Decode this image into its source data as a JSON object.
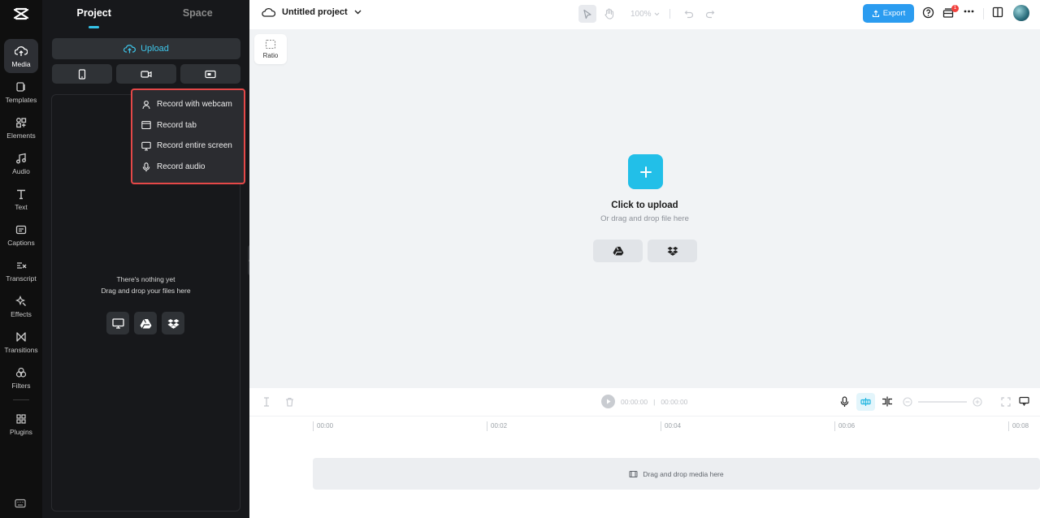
{
  "rail": {
    "items": [
      {
        "label": "Media",
        "icon": "cloud-upload-icon"
      },
      {
        "label": "Templates",
        "icon": "templates-icon"
      },
      {
        "label": "Elements",
        "icon": "elements-icon"
      },
      {
        "label": "Audio",
        "icon": "music-note-icon"
      },
      {
        "label": "Text",
        "icon": "text-icon"
      },
      {
        "label": "Captions",
        "icon": "captions-icon"
      },
      {
        "label": "Transcript",
        "icon": "transcript-icon"
      },
      {
        "label": "Effects",
        "icon": "effects-icon"
      },
      {
        "label": "Transitions",
        "icon": "transitions-icon"
      },
      {
        "label": "Filters",
        "icon": "filters-icon"
      },
      {
        "label": "Plugins",
        "icon": "plugins-icon"
      }
    ]
  },
  "panel": {
    "tabs": [
      "Project",
      "Space"
    ],
    "upload_label": "Upload",
    "record_menu": [
      "Record with webcam",
      "Record tab",
      "Record entire screen",
      "Record audio"
    ],
    "empty_title": "There's nothing yet",
    "empty_hint": "Drag and drop your files here"
  },
  "header": {
    "project_name": "Untitled project",
    "zoom": "100%",
    "export_label": "Export",
    "notification_count": "1"
  },
  "canvas": {
    "ratio_label": "Ratio",
    "upload_title": "Click to upload",
    "upload_hint": "Or drag and drop file here"
  },
  "timeline": {
    "current_time": "00:00:00",
    "total_time": "00:00:00",
    "ticks": [
      "00:00",
      "00:02",
      "00:04",
      "00:06",
      "00:08"
    ],
    "drop_hint": "Drag and drop media here"
  },
  "colors": {
    "accent": "#22bfe8",
    "export": "#2b9cf0",
    "highlight_border": "#e54848"
  }
}
